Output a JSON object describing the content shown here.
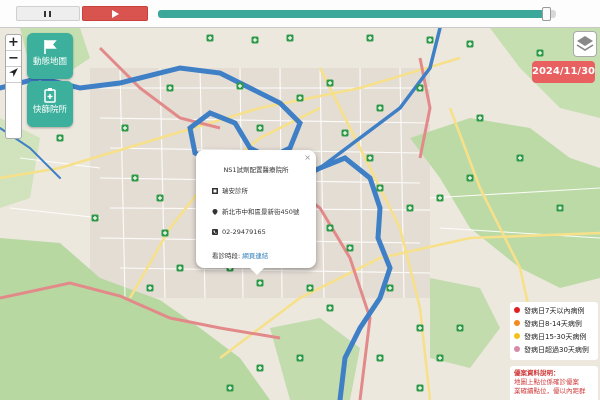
{
  "controls": {
    "pause_icon": "pause-icon",
    "play_icon": "play-icon",
    "timeline_progress": 0.975,
    "zoom_in": "+",
    "zoom_out": "−",
    "locate_icon": "locate-arrow-icon",
    "layers_icon": "layers-icon"
  },
  "menu": {
    "animation_map": "動態地圖",
    "rapid_clinic": "快篩院所"
  },
  "date_badge": "2024/11/30",
  "popup": {
    "title": "NS1試劑配置醫療院所",
    "name": "瑞安診所",
    "address": "新北市中和區景新街450號",
    "phone": "02-29479165",
    "hours_label": "看診時段:",
    "hours_link": "網頁連結",
    "close": "×"
  },
  "legend": {
    "items": [
      {
        "label": "發病日7天以內病例",
        "color": "#e02020"
      },
      {
        "label": "發病日8-14天病例",
        "color": "#f08a1c"
      },
      {
        "label": "發病日15-30天病例",
        "color": "#f2c318"
      },
      {
        "label": "發病日超過30天病例",
        "color": "#d58aa8"
      }
    ]
  },
  "info": {
    "heading": "優案資料說明：",
    "line1": "地圖上點位係確診優案",
    "line2": "業確續點位，優以內距群",
    "line3": "總點為「優以內點異..."
  },
  "map": {
    "clinic_color": "#2e9a48",
    "river_color": "#3e7fc6",
    "highway_color": "#e28a8a"
  }
}
